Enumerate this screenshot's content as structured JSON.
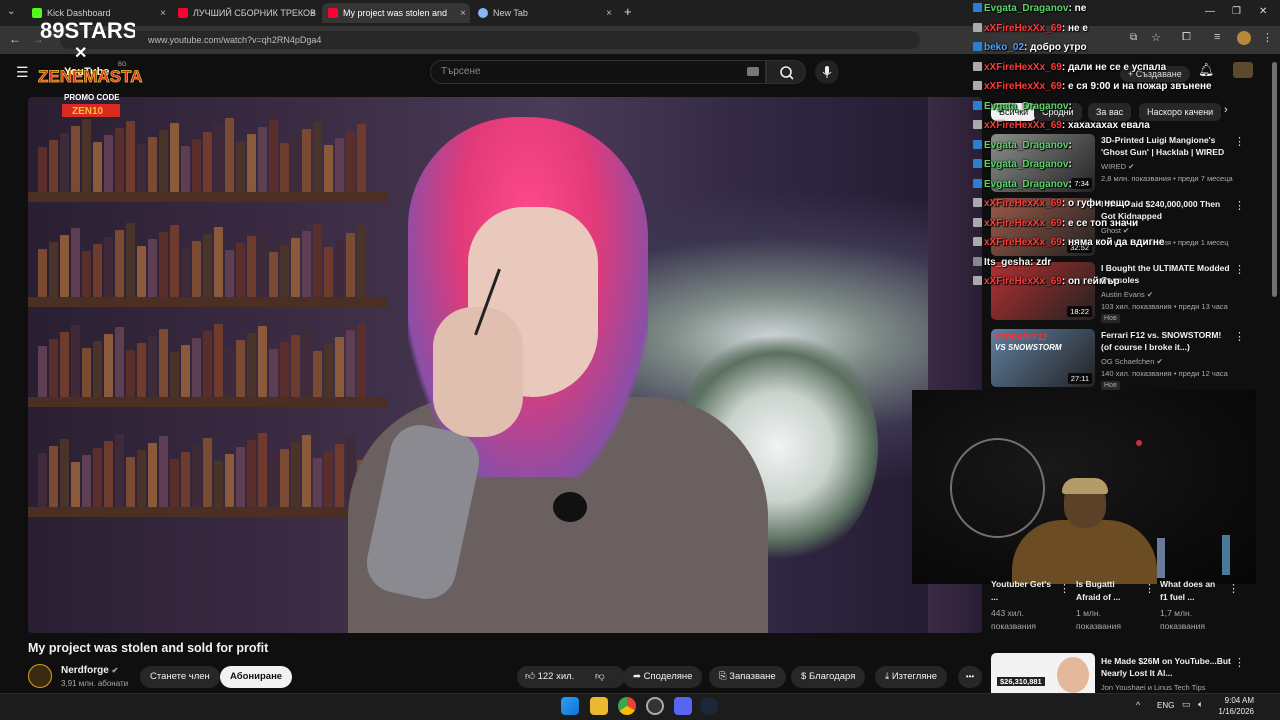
{
  "browser": {
    "tabs": [
      {
        "label": "Kick Dashboard",
        "active": false
      },
      {
        "label": "ЛУЧШИЙ СБОРНИК ТРЕКОВ",
        "active": false
      },
      {
        "label": "My project was stolen and",
        "active": true
      },
      {
        "label": "New Tab",
        "active": false
      }
    ],
    "new_tab": "+",
    "close_glyph": "×",
    "url": "www.youtube.com/watch?v=qh2RN4pDga4",
    "window_controls": [
      "—",
      "❐",
      "✕"
    ]
  },
  "youtube": {
    "logo_text": "YouTube",
    "logo_superscript": "BG",
    "search_placeholder": "Търсене",
    "create_label": "+ Създаване"
  },
  "video": {
    "title": "My project was stolen and sold for profit",
    "channel": {
      "name": "Nerdforge",
      "subscribers": "3,91 млн. абонати",
      "join_label": "Станете член",
      "subscribe_label": "Абониране"
    },
    "actions": {
      "likes": "122 хил.",
      "share": "Споделяне",
      "save": "Запазване",
      "thanks": "Благодаря",
      "download": "Изтегляне",
      "more": "•••"
    }
  },
  "chips": [
    "Всички",
    "Сродни",
    "За вас",
    "Наскоро качени"
  ],
  "related": [
    {
      "title": "3D-Printed Luigi Mangione's 'Ghost Gun' | Hacklab | WIRED",
      "channel": "WIRED",
      "meta": "2,8 млн. показвания • преди 7 месеца",
      "duration": "7:34",
      "badge": "",
      "thumb_color": "#8b8f8c"
    },
    {
      "title": "I Was Paid $240,000,000 Then Got Kidnapped",
      "channel": "Ghost",
      "meta": "1,2 млн. показвания • преди 1 месец",
      "duration": "32:52",
      "badge": "",
      "thumb_color": "#9a5a4a"
    },
    {
      "title": "I Bought the ULTIMATE Modded Consoles",
      "channel": "Austin Evans",
      "meta": "103 хил. показвания • преди 13 часа",
      "duration": "18:22",
      "badge": "Нов",
      "thumb_color": "#b32f2f"
    },
    {
      "title": "Ferrari F12 vs. SNOWSTORM! (of course I broke it...)",
      "channel": "OG Schaefchen",
      "meta": "140 хил. показвания • преди 12 часа",
      "duration": "27:11",
      "badge": "Нов",
      "thumb_color": "#5f7fa0"
    }
  ],
  "ferrari_thumb_text": [
    "FERRARI F12",
    "VS SNOWSTORM"
  ],
  "shorts": [
    {
      "title": "Youtuber Get's ...",
      "views": "443 хил.",
      "views_label": "показвания"
    },
    {
      "title": "Is Bugatti Afraid of ...",
      "views": "1 млн.",
      "views_label": "показвания"
    },
    {
      "title": "What does an f1 fuel ...",
      "views": "1,7 млн.",
      "views_label": "показвания"
    }
  ],
  "bottom_related": {
    "title": "He Made $26M on YouTube...But Nearly Lost It Al...",
    "channel": "Jon Youshaei и Linus Tech Tips",
    "thumb_amount": "$26,310,881"
  },
  "chat": [
    {
      "user": "Evgata_Draganov",
      "color": "green",
      "message": "ne"
    },
    {
      "user": "xXFireHexXx_69",
      "color": "red",
      "message": "не е"
    },
    {
      "user": "beko_02",
      "color": "blue",
      "message": "добро утро"
    },
    {
      "user": "xXFireHexXx_69",
      "color": "red",
      "message": "дали не се е успала"
    },
    {
      "user": "xXFireHexXx_69",
      "color": "red",
      "message": "е ся 9:00 и на пожар звънене"
    },
    {
      "user": "Evgata_Draganov",
      "color": "green",
      "message": ""
    },
    {
      "user": "xXFireHexXx_69",
      "color": "red",
      "message": "хахахахах евала"
    },
    {
      "user": "Evgata_Draganov",
      "color": "green",
      "message": ""
    },
    {
      "user": "Evgata_Draganov",
      "color": "green",
      "message": ""
    },
    {
      "user": "Evgata_Draganov",
      "color": "green",
      "message": ""
    },
    {
      "user": "xXFireHexXx_69",
      "color": "red",
      "message": "о гуфи нещо"
    },
    {
      "user": "xXFireHexXx_69",
      "color": "red",
      "message": "е се топ значи"
    },
    {
      "user": "xXFireHexXx_69",
      "color": "red",
      "message": "няма кой да вдигне"
    },
    {
      "user": "Its_gesha",
      "color": "white",
      "message": "zdr"
    },
    {
      "user": "xXFireHexXx_69",
      "color": "red",
      "message": "on геймър"
    }
  ],
  "overlays": {
    "stars_logo": "89STARS",
    "promo_brand": "ZENEMASTA",
    "promo_line": "PROMO CODE",
    "promo_code": "ZEN10"
  },
  "taskbar": {
    "lang": "ENG",
    "time": "9:04 AM",
    "date": "1/16/2026",
    "tray_up": "^"
  }
}
